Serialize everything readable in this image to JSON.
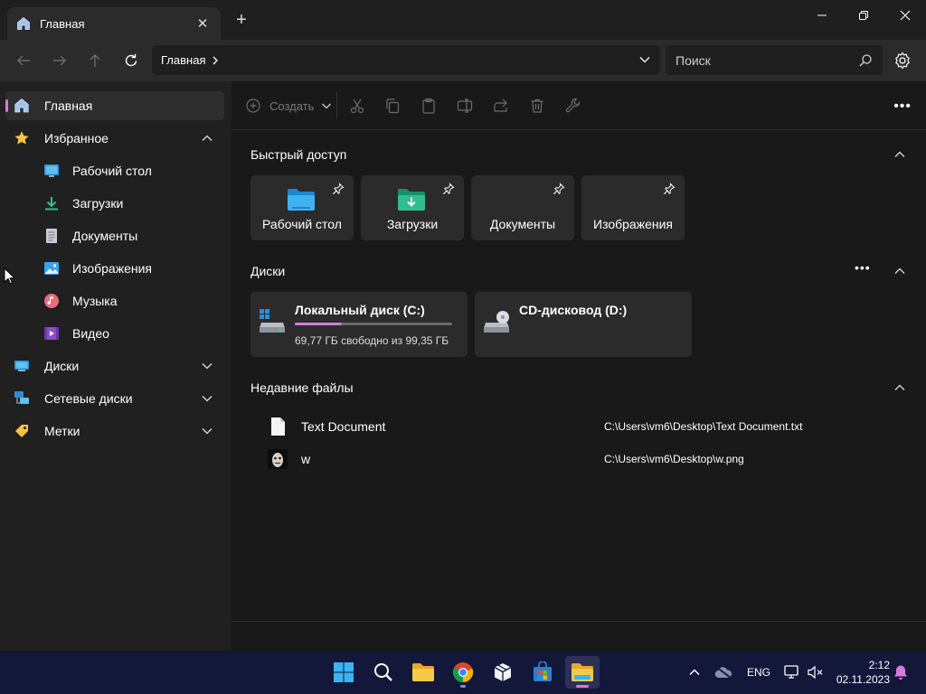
{
  "window": {
    "tab_title": "Главная",
    "tab_close": "✕",
    "new_tab": "+"
  },
  "address": {
    "crumb": "Главная",
    "search_placeholder": "Поиск"
  },
  "sidebar": {
    "items": [
      {
        "label": "Главная",
        "icon": "home-icon",
        "active": true
      },
      {
        "label": "Избранное",
        "icon": "star-icon",
        "expanded": true
      },
      {
        "label": "Рабочий стол",
        "icon": "desktop-icon"
      },
      {
        "label": "Загрузки",
        "icon": "downloads-icon"
      },
      {
        "label": "Документы",
        "icon": "documents-icon"
      },
      {
        "label": "Изображения",
        "icon": "pictures-icon"
      },
      {
        "label": "Музыка",
        "icon": "music-icon"
      },
      {
        "label": "Видео",
        "icon": "video-icon"
      },
      {
        "label": "Диски",
        "icon": "drives-icon",
        "expanded": false
      },
      {
        "label": "Сетевые диски",
        "icon": "network-icon",
        "expanded": false
      },
      {
        "label": "Метки",
        "icon": "tag-icon",
        "expanded": false
      }
    ]
  },
  "toolbar": {
    "create_label": "Создать",
    "more": "•••"
  },
  "quick_access": {
    "title": "Быстрый доступ",
    "items": [
      {
        "label": "Рабочий стол",
        "icon": "desktop-folder-icon"
      },
      {
        "label": "Загрузки",
        "icon": "downloads-folder-icon"
      },
      {
        "label": "Документы",
        "icon": "documents-folder-icon"
      },
      {
        "label": "Изображения",
        "icon": "pictures-folder-icon"
      }
    ]
  },
  "drives": {
    "title": "Диски",
    "more": "•••",
    "items": [
      {
        "name": "Локальный диск (C:)",
        "space": "69,77 ГБ свободно из 99,35 ГБ",
        "used_fraction": 0.3
      },
      {
        "name": "CD-дисковод (D:)"
      }
    ]
  },
  "recent": {
    "title": "Недавние файлы",
    "items": [
      {
        "name": "Text Document",
        "path": "C:\\Users\\vm6\\Desktop\\Text Document.txt",
        "icon": "text-file-icon"
      },
      {
        "name": "w",
        "path": "C:\\Users\\vm6\\Desktop\\w.png",
        "icon": "image-thumbnail-icon"
      }
    ]
  },
  "taskbar": {
    "lang": "ENG",
    "time": "2:12",
    "date": "02.11.2023"
  },
  "colors": {
    "accent": "#d47bd8",
    "taskbar": "#13173a"
  }
}
